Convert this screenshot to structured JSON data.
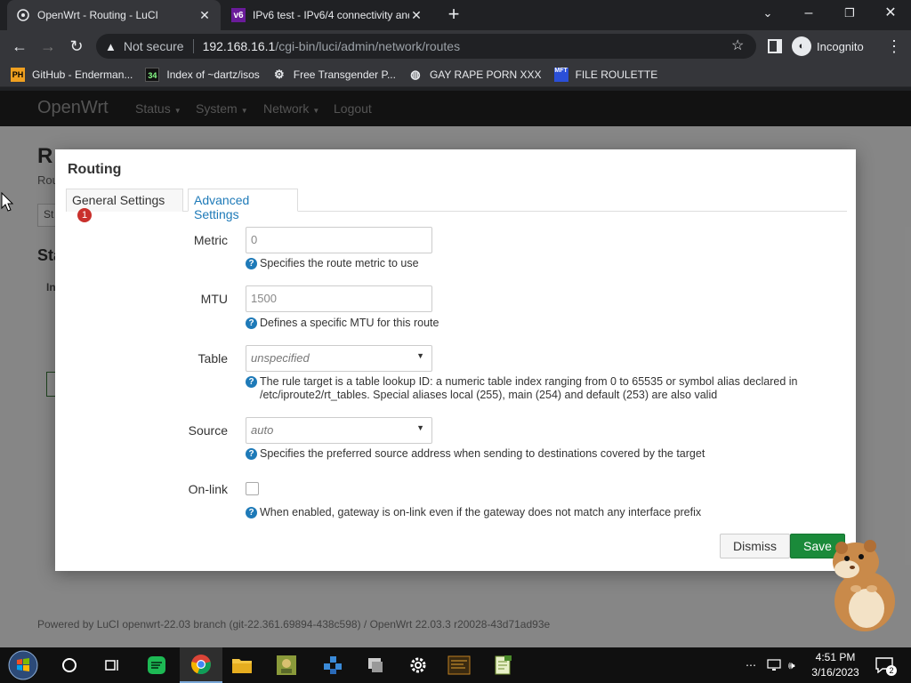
{
  "browser": {
    "tabs": [
      {
        "title": "OpenWrt - Routing - LuCI",
        "favicon": "openwrt-icon"
      },
      {
        "title": "IPv6 test - IPv6/4 connectivity and",
        "favicon": "v6"
      }
    ],
    "url_warning": "Not secure",
    "url_host": "192.168.16.1",
    "url_path": "/cgi-bin/luci/admin/network/routes",
    "incognito_label": "Incognito",
    "bookmarks": [
      {
        "label": "GitHub - Enderman...",
        "icon": "PH"
      },
      {
        "label": "Index of ~dartz/isos",
        "icon": "34"
      },
      {
        "label": "Free Transgender P...",
        "icon": "gear-bookmark-icon"
      },
      {
        "label": "GAY RAPE PORN XXX",
        "icon": "globe-icon"
      },
      {
        "label": "FILE ROULETTE",
        "icon": "MFT"
      }
    ]
  },
  "luci": {
    "brand": "OpenWrt",
    "menu": [
      "Status",
      "System",
      "Network",
      "Logout"
    ],
    "bg_title": "R",
    "bg_sub": "Rou",
    "bg_st": "St",
    "bg_heading": "Sta",
    "bg_col": "In",
    "footer": "Powered by LuCI openwrt-22.03 branch (git-22.361.69894-438c598) / OpenWrt 22.03.3 r20028-43d71ad93e"
  },
  "modal": {
    "title": "Routing",
    "tabs": {
      "general": "General Settings",
      "general_badge": "1",
      "advanced": "Advanced Settings"
    },
    "fields": {
      "metric": {
        "label": "Metric",
        "placeholder": "0",
        "help": "Specifies the route metric to use"
      },
      "mtu": {
        "label": "MTU",
        "placeholder": "1500",
        "help": "Defines a specific MTU for this route"
      },
      "table": {
        "label": "Table",
        "value": "unspecified",
        "help": "The rule target is a table lookup ID: a numeric table index ranging from 0 to 65535 or symbol alias declared in /etc/iproute2/rt_tables. Special aliases local (255), main (254) and default (253) are also valid"
      },
      "source": {
        "label": "Source",
        "value": "auto",
        "help": "Specifies the preferred source address when sending to destinations covered by the target"
      },
      "onlink": {
        "label": "On-link",
        "checked": false,
        "help": "When enabled, gateway is on-link even if the gateway does not match any interface prefix"
      }
    },
    "buttons": {
      "dismiss": "Dismiss",
      "save": "Save"
    }
  },
  "taskbar": {
    "time": "4:51 PM",
    "date": "3/16/2023",
    "notifications": "2",
    "accent": "#7aa8d8"
  }
}
